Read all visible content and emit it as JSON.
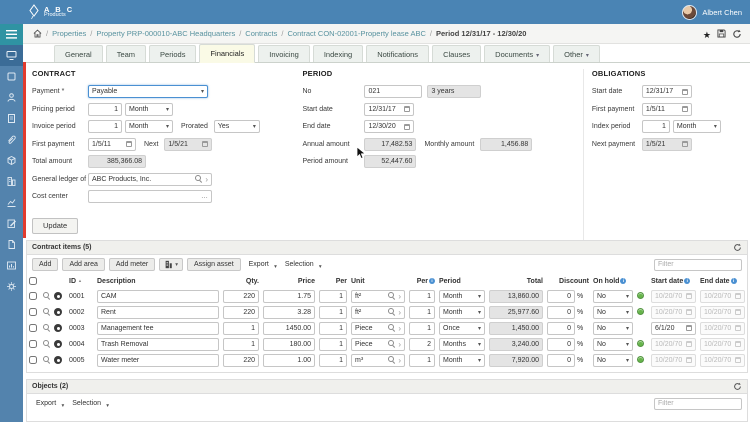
{
  "colors": {
    "topbar_blue": "#4a84b4",
    "sidebar_blue": "#5383ad",
    "hamburger_teal": "#2f93a3",
    "active_nav": "#3b6c97",
    "red_indicator": "#e23b2e",
    "green_status": "#67b54b",
    "active_tab_bg": "#fafae6",
    "link_teal": "#58929f"
  },
  "topbar": {
    "logo_line1": "A B C",
    "logo_line2": "Products",
    "user_name": "Albert Chen"
  },
  "breadcrumb": {
    "links": [
      "Properties",
      "Property PRP-000010-ABC Headquarters",
      "Contracts",
      "Contract CON-02001-Property lease ABC"
    ],
    "current": "Period 12/31/17 - 12/30/20"
  },
  "tabs": {
    "t0": "General",
    "t1": "Team",
    "t2": "Periods",
    "t3": "Financials",
    "t4": "Invoicing",
    "t5": "Indexing",
    "t6": "Notifications",
    "t7": "Clauses",
    "t8": "Documents",
    "t9": "Other",
    "active": "Financials"
  },
  "contract": {
    "title": "CONTRACT",
    "payment_label": "Payment *",
    "payment": "Payable",
    "pricing_period_label": "Pricing period",
    "pricing_period_num": "1",
    "pricing_period_unit": "Month",
    "invoice_period_label": "Invoice period",
    "invoice_period_num": "1",
    "invoice_period_unit": "Month",
    "prorated_label": "Prorated",
    "prorated": "Yes",
    "first_payment_label": "First payment",
    "first_payment": "1/5/11",
    "next_label": "Next",
    "next_payment": "1/5/21",
    "total_amount_label": "Total amount",
    "total_amount": "385,366.08",
    "general_ledger_label": "General ledger of",
    "general_ledger": "ABC Products, Inc.",
    "cost_center_label": "Cost center",
    "cost_center": "",
    "update_button": "Update"
  },
  "period": {
    "title": "PERIOD",
    "no_label": "No",
    "no": "021",
    "duration": "3 years",
    "start_date_label": "Start date",
    "start_date": "12/31/17",
    "end_date_label": "End date",
    "end_date": "12/30/20",
    "annual_label": "Annual amount",
    "annual": "17,482.53",
    "monthly_label": "Monthly amount",
    "monthly": "1,456.88",
    "period_amount_label": "Period amount",
    "period_amount": "52,447.60"
  },
  "obligations": {
    "title": "OBLIGATIONS",
    "start_date_label": "Start date",
    "start_date": "12/31/17",
    "first_payment_label": "First payment",
    "first_payment": "1/5/11",
    "index_period_label": "Index period",
    "index_period_num": "1",
    "index_period_unit": "Month",
    "next_payment_label": "Next payment",
    "next_payment": "1/5/21"
  },
  "contract_items": {
    "title": "Contract items (5)",
    "buttons": {
      "add": "Add",
      "add_area": "Add area",
      "add_meter": "Add meter",
      "assign_asset": "Assign asset",
      "export": "Export",
      "selection": "Selection"
    },
    "filter_placeholder": "Filter",
    "percent_sign": "%",
    "columns": {
      "id": "ID",
      "description": "Description",
      "qty": "Qty.",
      "price": "Price",
      "per1": "Per",
      "unit": "Unit",
      "per2": "Per",
      "period": "Period",
      "total": "Total",
      "discount": "Discount",
      "on_hold": "On hold",
      "start_date": "Start date",
      "end_date": "End date"
    },
    "rows": [
      {
        "id": "0001",
        "description": "CAM",
        "qty": "220",
        "price": "1.75",
        "per1": "1",
        "unit": "ft²",
        "per2": "1",
        "period": "Month",
        "total": "13,860.00",
        "discount": "0",
        "on_hold": "No",
        "indicator": true,
        "start_date": "10/20/70",
        "start_muted": true,
        "end_date": "10/20/70",
        "end_muted": true
      },
      {
        "id": "0002",
        "description": "Rent",
        "qty": "220",
        "price": "3.28",
        "per1": "1",
        "unit": "ft²",
        "per2": "1",
        "period": "Month",
        "total": "25,977.60",
        "discount": "0",
        "on_hold": "No",
        "indicator": true,
        "start_date": "10/20/70",
        "start_muted": true,
        "end_date": "10/20/70",
        "end_muted": true
      },
      {
        "id": "0003",
        "description": "Management fee",
        "qty": "1",
        "price": "1450.00",
        "per1": "1",
        "unit": "Piece",
        "per2": "1",
        "period": "Once",
        "total": "1,450.00",
        "discount": "0",
        "on_hold": "No",
        "indicator": false,
        "start_date": "6/1/20",
        "start_muted": false,
        "end_date": "10/20/70",
        "end_muted": true
      },
      {
        "id": "0004",
        "description": "Trash Removal",
        "qty": "1",
        "price": "180.00",
        "per1": "1",
        "unit": "Piece",
        "per2": "2",
        "period": "Months",
        "total": "3,240.00",
        "discount": "0",
        "on_hold": "No",
        "indicator": true,
        "start_date": "10/20/70",
        "start_muted": true,
        "end_date": "10/20/70",
        "end_muted": true
      },
      {
        "id": "0005",
        "description": "Water meter",
        "qty": "220",
        "price": "1.00",
        "per1": "1",
        "unit": "m³",
        "per2": "1",
        "period": "Month",
        "total": "7,920.00",
        "discount": "0",
        "on_hold": "No",
        "indicator": true,
        "start_date": "10/20/70",
        "start_muted": true,
        "end_date": "10/20/70",
        "end_muted": true
      }
    ]
  },
  "objects": {
    "title": "Objects (2)",
    "export": "Export",
    "selection": "Selection",
    "filter_placeholder": "Filter"
  }
}
